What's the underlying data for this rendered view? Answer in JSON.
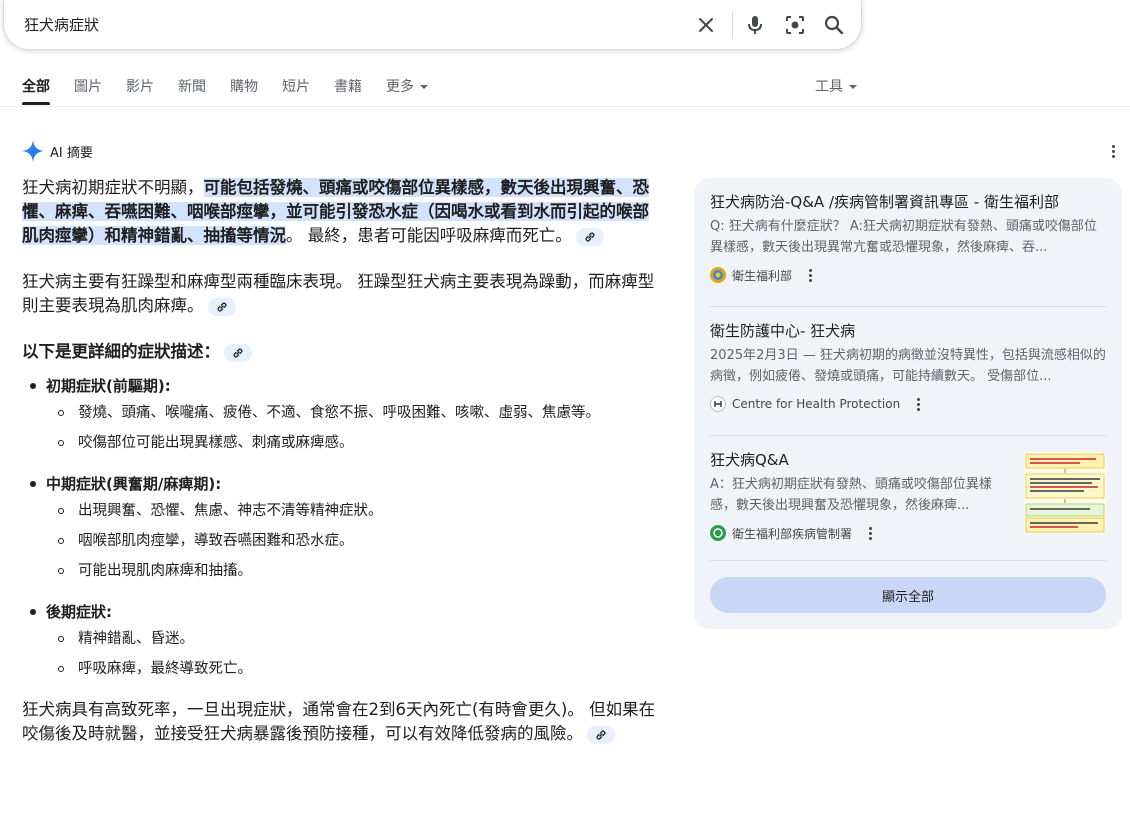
{
  "search": {
    "query": "狂犬病症狀",
    "icons": [
      "close-icon",
      "mic-icon",
      "lens-icon",
      "search-icon"
    ]
  },
  "tabs": [
    {
      "label": "全部",
      "active": true
    },
    {
      "label": "圖片"
    },
    {
      "label": "影片"
    },
    {
      "label": "新聞"
    },
    {
      "label": "購物"
    },
    {
      "label": "短片"
    },
    {
      "label": "書籍"
    },
    {
      "label": "更多"
    }
  ],
  "tools_label": "工具",
  "ai": {
    "header": "AI 摘要",
    "p1_start": "狂犬病初期症狀不明顯，",
    "p1_highlight": "可能包括發燒、頭痛或咬傷部位異樣感，數天後出現興奮、恐懼、麻痺、吞嚥困難、咽喉部痙攣，並可能引發恐水症（因喝水或看到水而引起的喉部肌肉痙攣）和精神錯亂、抽搐等情況",
    "p1_end": "。 最終，患者可能因呼吸麻痺而死亡。",
    "p2": "狂犬病主要有狂躁型和麻痺型兩種臨床表現。 狂躁型狂犬病主要表現為躁動，而麻痺型則主要表現為肌肉麻痺。",
    "subhead": "以下是更詳細的症狀描述：",
    "phases": [
      {
        "title": "初期症狀(前驅期):",
        "items": [
          "發燒、頭痛、喉嚨痛、疲倦、不適、食慾不振、呼吸困難、咳嗽、虛弱、焦慮等。",
          "咬傷部位可能出現異樣感、刺痛或麻痺感。"
        ]
      },
      {
        "title": "中期症狀(興奮期/麻痺期):",
        "items": [
          "出現興奮、恐懼、焦慮、神志不清等精神症狀。",
          "咽喉部肌肉痙攣，導致吞嚥困難和恐水症。",
          "可能出現肌肉麻痺和抽搐。"
        ]
      },
      {
        "title": "後期症狀:",
        "items": [
          "精神錯亂、昏迷。",
          "呼吸麻痺，最終導致死亡。"
        ]
      }
    ],
    "p3": "狂犬病具有高致死率，一旦出現症狀，通常會在2到6天內死亡(有時會更久)。 但如果在咬傷後及時就醫，並接受狂犬病暴露後預防接種，可以有效降低發病的風險。"
  },
  "sources": [
    {
      "title": "狂犬病防治-Q&A /疾病管制署資訊專區 - 衛生福利部",
      "snippet": "Q: 狂犬病有什麼症狀？ A:狂犬病初期症狀有發熱、頭痛或咬傷部位異樣感，數天後出現異常亢奮或恐懼現象，然後麻痺、吞...",
      "site": "衛生福利部"
    },
    {
      "title": "衛生防護中心- 狂犬病",
      "snippet": "2025年2月3日 — 狂犬病初期的病徵並沒特異性，包括與流感相似的病徵，例如疲倦、發燒或頭痛，可能持續數天。 受傷部位...",
      "site": "Centre for Health Protection"
    },
    {
      "title": "狂犬病Q&A",
      "snippet": "A：狂犬病初期症狀有發熱、頭痛或咬傷部位異樣感，數天後出現興奮及恐懼現象，然後麻痺...",
      "site": "衛生福利部疾病管制署"
    }
  ],
  "show_all_label": "顯示全部",
  "colors": {
    "accent": "#0b57d0",
    "highlight": "#d3e3fd",
    "panel_bg": "#f0f4f9",
    "button_bg": "#c7d7f5"
  }
}
